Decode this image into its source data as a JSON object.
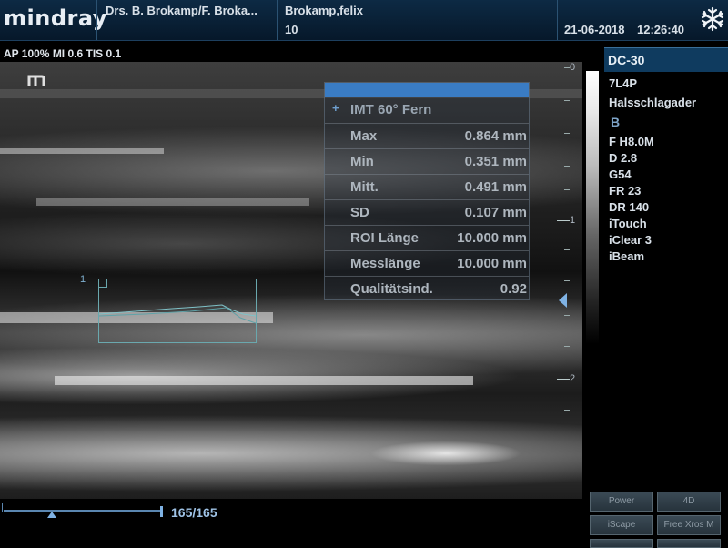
{
  "header": {
    "brand": "mindray",
    "institution": "Drs. B. Brokamp/F. Broka...",
    "patient_name": "Brokamp,felix",
    "patient_id": "10",
    "date": "21-06-2018",
    "time": "12:26:40",
    "freeze_icon": "snowflake-icon"
  },
  "acoustic_params": "AP 100%  MI 0.6  TIS 0.1",
  "measurement": {
    "title": "IMT 60° Fern",
    "rows": [
      {
        "label": "Max",
        "value": "0.864 mm"
      },
      {
        "label": "Min",
        "value": "0.351 mm"
      },
      {
        "label": "Mitt.",
        "value": "0.491 mm"
      },
      {
        "label": "SD",
        "value": "0.107 mm"
      },
      {
        "label": "ROI Länge",
        "value": "10.000 mm"
      },
      {
        "label": "Messlänge",
        "value": "10.000 mm"
      },
      {
        "label": "Qualitätsind.",
        "value": "0.92"
      }
    ]
  },
  "roi": {
    "label": "1"
  },
  "depth_scale": {
    "labels": [
      "0",
      "1",
      "2"
    ]
  },
  "side_panel": {
    "probe": "DC-30",
    "transducer": "7L4P",
    "exam": "Halsschlagader",
    "mode": "B",
    "settings": [
      "F H8.0M",
      "D 2.8",
      "G54",
      "FR 23",
      "DR 140",
      "iTouch",
      "iClear 3",
      "iBeam"
    ]
  },
  "buttons": [
    {
      "label": "Power"
    },
    {
      "label": "4D"
    },
    {
      "label": "iScape"
    },
    {
      "label": "Free Xros M"
    }
  ],
  "cine": {
    "frame_label": "165/165"
  },
  "colors": {
    "header_bg": "#0d2a44",
    "accent_blue": "#3a7cc4",
    "roi_teal": "#6aa8ae",
    "probe_bar": "#0f3b5f"
  }
}
